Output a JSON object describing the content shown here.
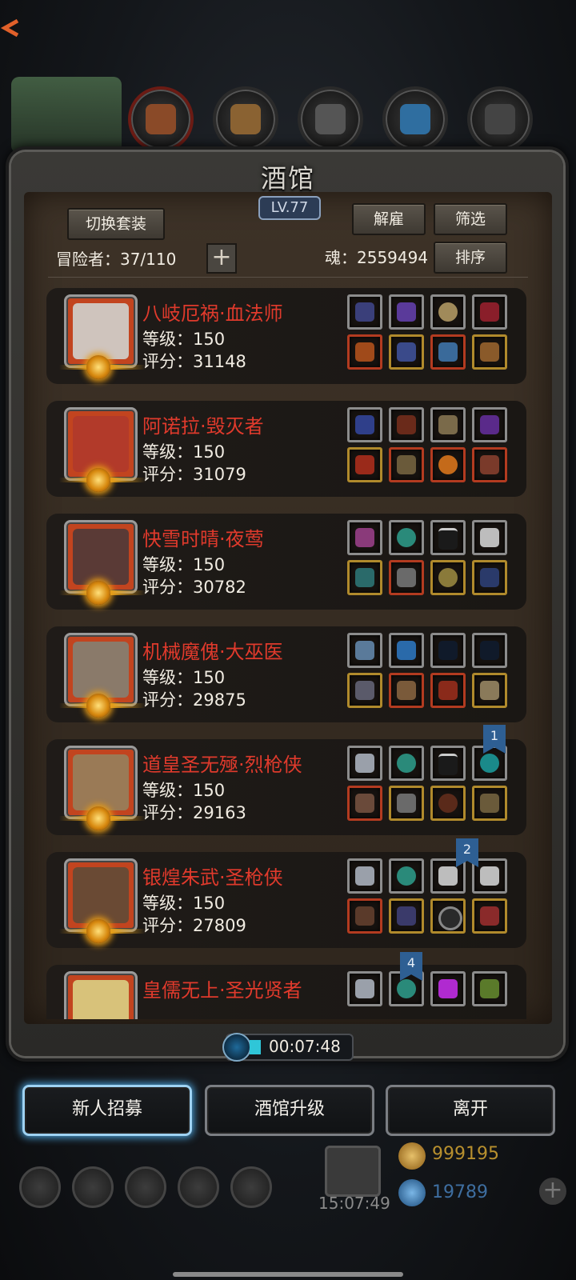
{
  "title": "酒馆",
  "level": "LV.77",
  "buttons": {
    "switch_outfit": "切换套装",
    "dismiss": "解雇",
    "filter": "筛选",
    "sort": "排序"
  },
  "adventurers": {
    "label": "冒险者：37/110"
  },
  "soul": {
    "label": "魂：2559494"
  },
  "heroes": [
    {
      "name": "八岐厄祸·血法师",
      "level": "等级：150",
      "score": "评分：31148",
      "face_color": "#cfc4bd"
    },
    {
      "name": "阿诺拉·毁灭者",
      "level": "等级：150",
      "score": "评分：31079",
      "face_color": "#b23a2a"
    },
    {
      "name": "快雪时晴·夜莺",
      "level": "等级：150",
      "score": "评分：30782",
      "face_color": "#5a3a36"
    },
    {
      "name": "机械魔傀·大巫医",
      "level": "等级：150",
      "score": "评分：29875",
      "face_color": "#8a7a6a"
    },
    {
      "name": "道皇圣无殛·烈枪侠",
      "level": "等级：150",
      "score": "评分：29163",
      "face_color": "#9a7a56"
    },
    {
      "name": "银煌朱武·圣枪侠",
      "level": "等级：150",
      "score": "评分：27809",
      "face_color": "#6a4a34"
    },
    {
      "name": "皇儒无上·圣光贤者",
      "level": "",
      "score": "",
      "face_color": "#d8c27a"
    }
  ],
  "bookmarks": [
    "1",
    "2",
    "4"
  ],
  "timer": "00:07:48",
  "actions": {
    "recruit": "新人招募",
    "upgrade": "酒馆升级",
    "leave": "离开"
  },
  "background": {
    "gold": "999195",
    "gems": "19789",
    "clock": "15:07:49"
  }
}
